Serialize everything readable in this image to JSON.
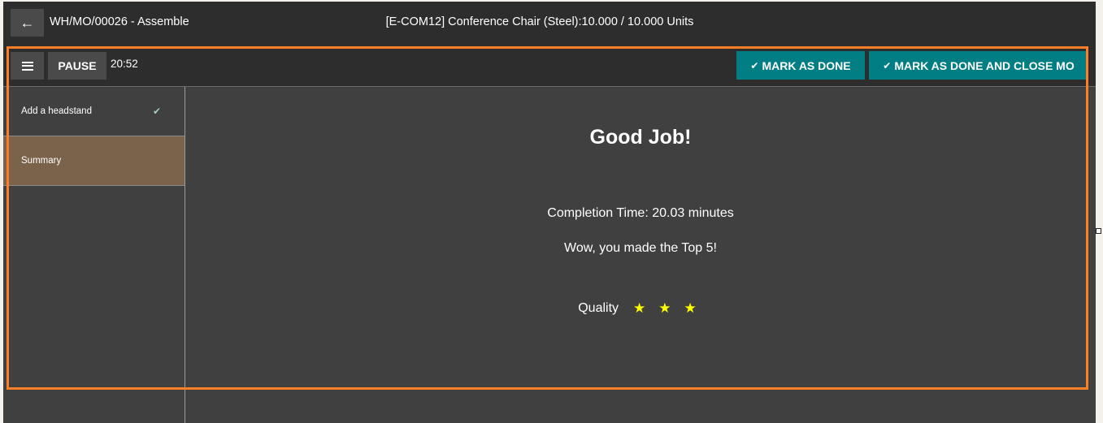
{
  "header": {
    "back_icon": "arrow-left-icon",
    "mo_title": "WH/MO/00026 - Assemble",
    "product_title": "[E-COM12] Conference Chair (Steel):10.000 / 10.000 Units"
  },
  "toolbar": {
    "menu_icon": "hamburger-icon",
    "pause_label": "PAUSE",
    "timer": "20:52",
    "mark_done_label": "MARK AS DONE",
    "mark_done_close_label": "MARK AS DONE AND CLOSE MO",
    "check_icon": "✔",
    "accent_color": "#017e84"
  },
  "sidebar": {
    "steps": [
      {
        "label": "Add a headstand",
        "done": true,
        "check": "✔"
      },
      {
        "label": "Summary",
        "active": true
      }
    ],
    "active_color": "#7b624b"
  },
  "summary": {
    "title": "Good Job!",
    "completion_time": "Completion Time: 20.03 minutes",
    "ranking": "Wow, you made the Top 5!",
    "quality_label": "Quality",
    "quality_rating": 3,
    "quality_max": 3,
    "star": "★"
  },
  "highlight_color": "#fc7f28"
}
